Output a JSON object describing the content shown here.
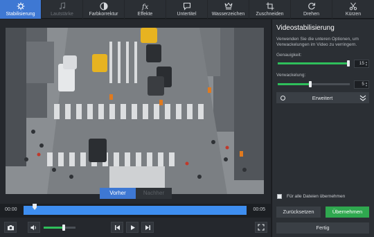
{
  "toolbar": {
    "items": [
      {
        "label": "Stabilisierung",
        "icon": "stabilize-icon"
      },
      {
        "label": "Lautstärke",
        "icon": "music-note-icon"
      },
      {
        "label": "Farbkorrektur",
        "icon": "color-correction-icon"
      },
      {
        "label": "Effekte",
        "icon": "fx-icon"
      },
      {
        "label": "Untertitel",
        "icon": "subtitle-icon"
      },
      {
        "label": "Wasserzeichen",
        "icon": "watermark-icon"
      },
      {
        "label": "Zuschneiden",
        "icon": "crop-icon"
      },
      {
        "label": "Drehen",
        "icon": "rotate-icon"
      },
      {
        "label": "Kürzen",
        "icon": "scissors-icon"
      }
    ],
    "active_color": "#3e78d3"
  },
  "preview": {
    "before_label": "Vorher",
    "after_label": "Nachher"
  },
  "timeline": {
    "start_time": "00:00",
    "end_time": "00:05",
    "position_fraction": 0.05
  },
  "volume": {
    "level_fraction": 0.62
  },
  "panel": {
    "title": "Videostabilisierung",
    "description": "Verwenden Sie die unteren Optionen, um Verwackelungen im Video zu verringern.",
    "accuracy": {
      "label": "Genauigkeit:",
      "value": "15",
      "fraction": 1.0
    },
    "shakiness": {
      "label": "Verwackelung:",
      "value": "5",
      "fraction": 0.45
    },
    "advanced_label": "Erweitert",
    "apply_all_label": "Für alle Dateien übernehmen",
    "reset_label": "Zurücksetzen",
    "apply_label": "Übernehmen",
    "done_label": "Fertig"
  },
  "colors": {
    "accent": "#3e78d3",
    "green": "#2fa84f",
    "timeline": "#3e8ef0"
  }
}
